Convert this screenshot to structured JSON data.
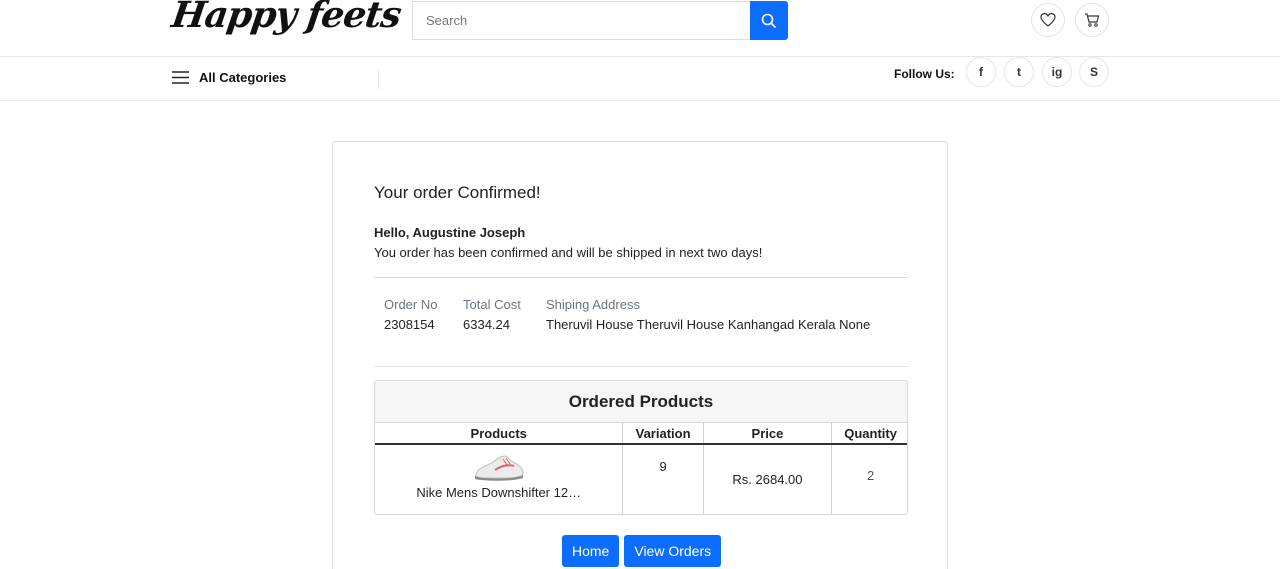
{
  "header": {
    "logo": "Happy feets",
    "search_placeholder": "Search"
  },
  "nav": {
    "categories_label": "All Categories",
    "follow_label": "Follow Us:",
    "social": [
      "f",
      "t",
      "ig",
      "S"
    ]
  },
  "order": {
    "title": "Your order Confirmed!",
    "greeting": "Hello, Augustine Joseph",
    "message": "You order has been confirmed and will be shipped in next two days!",
    "order_no_label": "Order No",
    "order_no": "2308154",
    "total_label": "Total Cost",
    "total": "6334.24",
    "address_label": "Shiping Address",
    "address": "Theruvil House Theruvil House Kanhangad Kerala None"
  },
  "products": {
    "heading": "Ordered Products",
    "columns": [
      "Products",
      "Variation",
      "Price",
      "Quantity"
    ],
    "rows": [
      {
        "name": "Nike Mens Downshifter 12…",
        "variation": "9",
        "price": "Rs. 2684.00",
        "quantity": "2"
      }
    ]
  },
  "actions": {
    "home": "Home",
    "view_orders": "View Orders"
  },
  "colors": {
    "accent": "#0d6efd"
  }
}
